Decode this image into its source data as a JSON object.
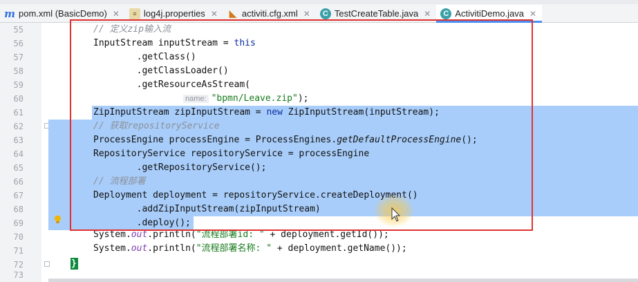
{
  "tabs": [
    {
      "label": "pom.xml (BasicDemo)",
      "icon": "maven-icon"
    },
    {
      "label": "log4j.properties",
      "icon": "properties-file-icon"
    },
    {
      "label": "activiti.cfg.xml",
      "icon": "xml-file-icon"
    },
    {
      "label": "TestCreateTable.java",
      "icon": "java-class-icon"
    },
    {
      "label": "ActivitiDemo.java",
      "icon": "java-class-icon",
      "active": true
    }
  ],
  "line_numbers": [
    "55",
    "56",
    "57",
    "58",
    "59",
    "60",
    "61",
    "62",
    "63",
    "64",
    "65",
    "66",
    "67",
    "68",
    "69",
    "70",
    "71",
    "72",
    "73"
  ],
  "code": {
    "l55": "// 定义zip输入流",
    "l56_a": "InputStream inputStream = ",
    "l56_b": "this",
    "l57": "        .getClass()",
    "l58": "        .getClassLoader()",
    "l59": "        .getResourceAsStream(",
    "l60_hint": "name:",
    "l60_str": "\"bpmn/Leave.zip\"",
    "l60_end": ");",
    "l61_a": "ZipInputStream zipInputStream = ",
    "l61_b": "new",
    "l61_c": " ZipInputStream(inputStream);",
    "l62": "// 获取repositoryService",
    "l63_a": "ProcessEngine processEngine = ProcessEngines.",
    "l63_b": "getDefaultProcessEngine",
    "l63_c": "();",
    "l64": "RepositoryService repositoryService = processEngine",
    "l65": "        .getRepositoryService();",
    "l66": "// 流程部署",
    "l67": "Deployment deployment = repositoryService.createDeployment()",
    "l68": "        .addZipInputStream(zipInputStream)",
    "l69": "        .deploy();",
    "l70_a": "System.",
    "l70_b": "out",
    "l70_c": ".println(",
    "l70_d": "\"流程部署id: \"",
    "l70_e": " + deployment.getId());",
    "l71_a": "System.",
    "l71_b": "out",
    "l71_c": ".println(",
    "l71_d": "\"流程部署名称: \"",
    "l71_e": " + deployment.getName());",
    "l72": "}"
  },
  "colors": {
    "selection": "#a8cdfa",
    "highlight_box": "#e1302e",
    "keyword": "#0b2f9e",
    "string": "#167a1b",
    "comment": "#8a8f99",
    "static_field": "#7a3eb0"
  }
}
